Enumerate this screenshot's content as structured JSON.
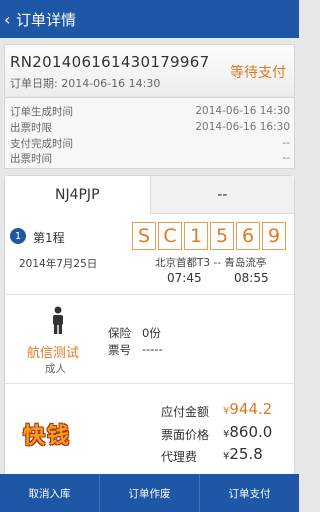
{
  "header": {
    "back_icon": "back-chevron-icon",
    "title": "订单详情"
  },
  "order": {
    "number": "RN201406161430179967",
    "date_label": "订单日期:",
    "date_value": "2014-06-16 14:30",
    "status": "等待支付",
    "status_color": "#e07a22"
  },
  "times": [
    {
      "label": "订单生成时间",
      "value": "2014-06-16 14:30"
    },
    {
      "label": "出票时限",
      "value": "2014-06-16 16:30"
    },
    {
      "label": "支付完成时间",
      "value": "--"
    },
    {
      "label": "出票时间",
      "value": "--"
    }
  ],
  "tabs": [
    {
      "label": "NJ4PJP",
      "active": true
    },
    {
      "label": "--",
      "active": false
    }
  ],
  "segment": {
    "index": "1",
    "label": "第1程",
    "date": "2014年7月25日",
    "flight_chars": [
      "S",
      "C",
      "1",
      "5",
      "6",
      "9"
    ],
    "route": "北京首都T3 -- 青岛流亭",
    "dep_time": "07:45",
    "arr_time": "08:55"
  },
  "passenger": {
    "icon": "person-icon",
    "name": "航信测试",
    "type": "成人",
    "insurance_label": "保险",
    "insurance_value": "0份",
    "ticket_label": "票号",
    "ticket_value": "-----"
  },
  "payment": {
    "logo_text": "快钱",
    "rows": [
      {
        "label": "应付金额",
        "yen": "¥",
        "value": "944.2",
        "accent": true
      },
      {
        "label": "票面价格",
        "yen": "¥",
        "value": "860.0",
        "accent": false
      },
      {
        "label": "代理费",
        "yen": "¥",
        "value": "25.8",
        "accent": false
      }
    ]
  },
  "bottom": {
    "cancel": "取消入库",
    "void": "订单作废",
    "pay": "订单支付"
  },
  "colors": {
    "brand": "#1d57a5",
    "accent": "#e07a22"
  }
}
